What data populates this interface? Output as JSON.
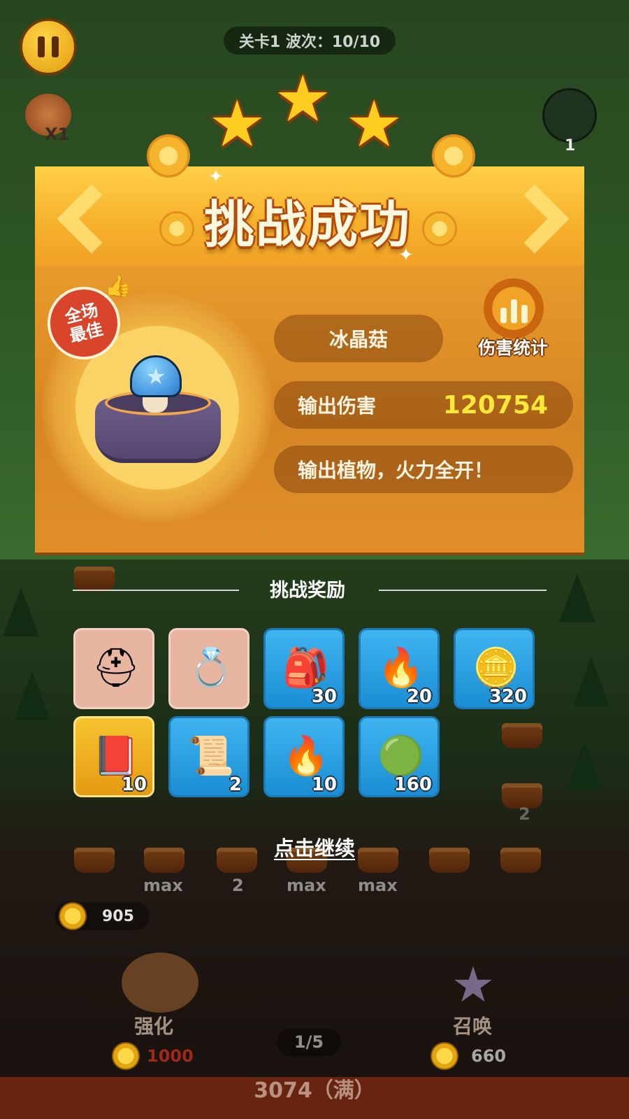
{
  "hud": {
    "stage_wave": "关卡1 波次：10/10",
    "speed": "X1",
    "zombie_count": "1"
  },
  "result": {
    "title": "挑战成功",
    "stars": 3,
    "best_badge": "全场\n最佳",
    "plant_name": "冰晶菇",
    "damage_label": "输出伤害",
    "damage_value": "120754",
    "slogan": "输出植物，火力全开！",
    "stats_label": "伤害统计"
  },
  "rewards": {
    "title": "挑战奖励",
    "items": [
      {
        "icon": "golden-helmet-icon",
        "count": "",
        "bg": "tan"
      },
      {
        "icon": "gold-ring-icon",
        "count": "",
        "bg": "tan"
      },
      {
        "icon": "purple-seed-bag-icon",
        "count": "30",
        "bg": "blue"
      },
      {
        "icon": "fire-seed-bag-icon",
        "count": "20",
        "bg": "blue"
      },
      {
        "icon": "clover-coin-icon",
        "count": "320",
        "bg": "blue"
      },
      {
        "icon": "exp-book-icon",
        "count": "10",
        "bg": "gold"
      },
      {
        "icon": "scroll-icon",
        "count": "2",
        "bg": "blue"
      },
      {
        "icon": "fire-seed-bag-icon",
        "count": "10",
        "bg": "blue"
      },
      {
        "icon": "green-orb-icon",
        "count": "160",
        "bg": "blue"
      }
    ],
    "continue": "点击继续"
  },
  "board": {
    "slot_labels": [
      "max",
      "2",
      "max",
      "max"
    ],
    "side_pot_level": "2",
    "sun_count": "905",
    "enhance_label": "强化",
    "enhance_cost": "1000",
    "summon_label": "召唤",
    "summon_cost": "660",
    "wave_progress": "1/5",
    "base_hp": "3074（满）"
  },
  "colors": {
    "damage_value": "#ffe83a",
    "enhance_cost": "#e03020",
    "banner": "#f7b12c",
    "panel": "#d68624"
  }
}
